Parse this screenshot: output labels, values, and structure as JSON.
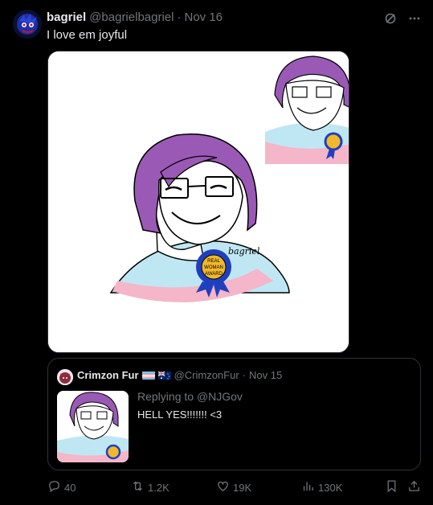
{
  "author": {
    "name": "bagriel",
    "handle": "@bagrielbagriel",
    "separator": "·",
    "date": "Nov 16"
  },
  "tweet": {
    "text": "I love em joyful"
  },
  "media": {
    "signature": "bagriel",
    "badge_text": [
      "REAL",
      "WOMAN",
      "AWARD"
    ],
    "colors": {
      "hair": "#9b59b6",
      "shirt_blue": "#bfe7f3",
      "shirt_pink": "#f4b6c8",
      "ribbon": "#1f3fbf",
      "medal": "#f1b82b"
    }
  },
  "quote": {
    "name": "Crimzon Fur",
    "handle": "@CrimzonFur",
    "separator": "·",
    "date": "Nov 15",
    "flags": [
      "transgender-flag",
      "australia-flag"
    ],
    "replying_to": "Replying to",
    "mention": "@NJGov",
    "text": "HELL YES!!!!!!! <3"
  },
  "actions": {
    "replies": "40",
    "reposts": "1.2K",
    "likes": "19K",
    "views": "130K"
  },
  "icons": [
    "grok-icon",
    "more-icon",
    "reply-icon",
    "repost-icon",
    "like-icon",
    "views-icon",
    "bookmark-icon",
    "share-icon"
  ],
  "colors": {
    "background": "#000000",
    "text_primary": "#e7e9ea",
    "text_secondary": "#71767b",
    "border": "#2f3336"
  }
}
